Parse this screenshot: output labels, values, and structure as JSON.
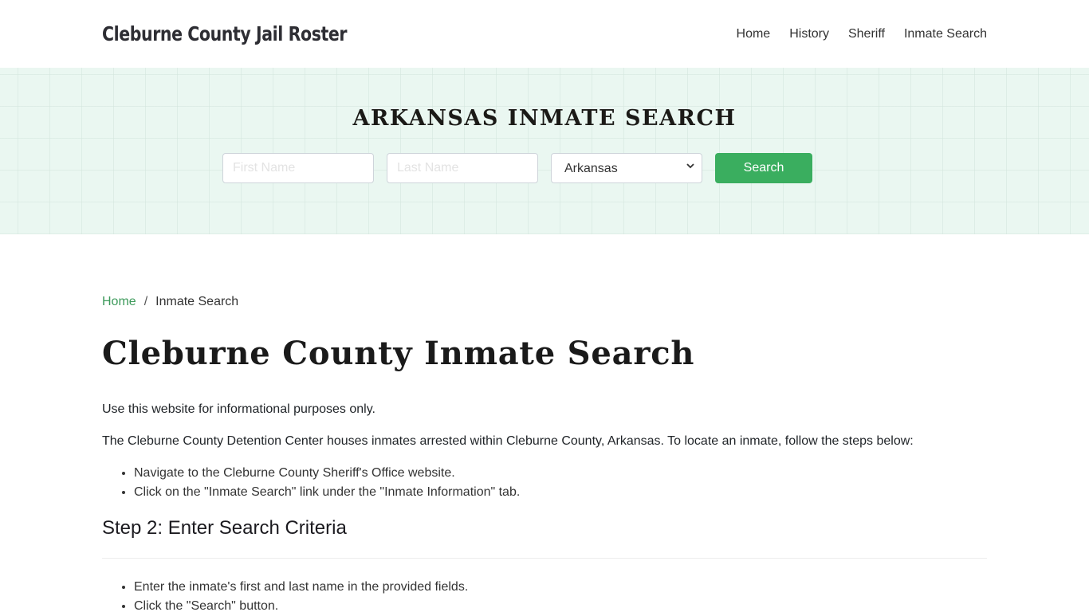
{
  "header": {
    "brand": "Cleburne County Jail Roster",
    "nav": [
      "Home",
      "History",
      "Sheriff",
      "Inmate Search"
    ]
  },
  "hero": {
    "title": "ARKANSAS INMATE SEARCH",
    "first_name_placeholder": "First Name",
    "last_name_placeholder": "Last Name",
    "state_selected": "Arkansas",
    "search_button": "Search"
  },
  "breadcrumb": {
    "home": "Home",
    "separator": "/",
    "current": "Inmate Search"
  },
  "main": {
    "title": "Cleburne County Inmate Search",
    "paragraphs": [
      "Use this website for informational purposes only.",
      "The Cleburne County Detention Center houses inmates arrested within Cleburne County, Arkansas. To locate an inmate, follow the steps below:"
    ],
    "list1": [
      "Navigate to the Cleburne County Sheriff's Office website.",
      "Click on the \"Inmate Search\" link under the \"Inmate Information\" tab."
    ],
    "step2_heading": "Step 2: Enter Search Criteria",
    "list2": [
      "Enter the inmate's first and last name in the provided fields.",
      "Click the \"Search\" button."
    ]
  },
  "colors": {
    "accent_green": "#3aae5f",
    "link_green": "#3d9a5b",
    "hero_bg": "#eaf7f1"
  }
}
